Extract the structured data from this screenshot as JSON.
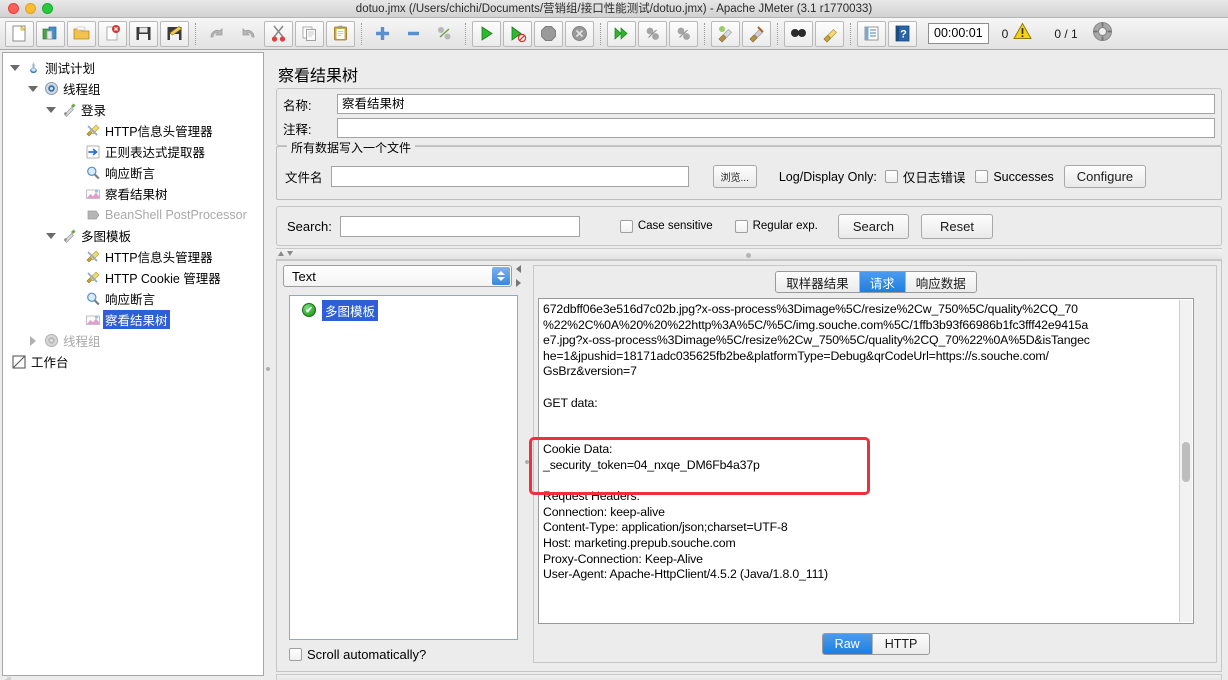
{
  "window": {
    "title": "dotuo.jmx (/Users/chichi/Documents/营销组/接口性能测试/dotuo.jmx) - Apache JMeter (3.1 r1770033)"
  },
  "toolbar": {
    "icons": [
      "new-file-icon",
      "open-template-icon",
      "open-folder-icon",
      "close-icon",
      "save-icon",
      "save-as-icon",
      "undo-icon",
      "redo-icon",
      "cut-icon",
      "copy-icon",
      "paste-icon",
      "expand-all-icon",
      "collapse-all-icon",
      "toggle-icon",
      "start-icon",
      "start-no-pauses-icon",
      "stop-icon",
      "shutdown-icon",
      "start-remote-icon",
      "stop-remote-icon",
      "shutdown-remote-icon",
      "clear-icon",
      "clear-all-icon",
      "search-icon",
      "reset-search-icon",
      "function-helper-icon",
      "help-icon"
    ],
    "timer": "00:00:01",
    "error_count": "0",
    "warning_icon": "warning-triangle-icon",
    "thread_count": "0 / 1",
    "target_icon": "remote-target-icon"
  },
  "tree": {
    "nodes": [
      {
        "label": "测试计划",
        "indent": 0,
        "twisty": "open",
        "icon": "test-plan-icon",
        "selected": false,
        "disabled": false
      },
      {
        "label": "线程组",
        "indent": 1,
        "twisty": "open",
        "icon": "thread-group-icon",
        "selected": false,
        "disabled": false
      },
      {
        "label": "登录",
        "indent": 2,
        "twisty": "open",
        "icon": "http-request-icon",
        "selected": false,
        "disabled": false
      },
      {
        "label": "HTTP信息头管理器",
        "indent": 3,
        "twisty": "none",
        "icon": "header-manager-icon",
        "selected": false,
        "disabled": false
      },
      {
        "label": "正则表达式提取器",
        "indent": 3,
        "twisty": "none",
        "icon": "regex-extractor-icon",
        "selected": false,
        "disabled": false
      },
      {
        "label": "响应断言",
        "indent": 3,
        "twisty": "none",
        "icon": "assertion-icon",
        "selected": false,
        "disabled": false
      },
      {
        "label": "察看结果树",
        "indent": 3,
        "twisty": "none",
        "icon": "view-results-tree-icon",
        "selected": false,
        "disabled": false
      },
      {
        "label": "BeanShell PostProcessor",
        "indent": 3,
        "twisty": "none",
        "icon": "beanshell-icon",
        "selected": false,
        "disabled": true
      },
      {
        "label": "多图模板",
        "indent": 2,
        "twisty": "open",
        "icon": "http-request-icon",
        "selected": false,
        "disabled": false
      },
      {
        "label": "HTTP信息头管理器",
        "indent": 3,
        "twisty": "none",
        "icon": "header-manager-icon",
        "selected": false,
        "disabled": false
      },
      {
        "label": "HTTP Cookie 管理器",
        "indent": 3,
        "twisty": "none",
        "icon": "cookie-manager-icon",
        "selected": false,
        "disabled": false
      },
      {
        "label": "响应断言",
        "indent": 3,
        "twisty": "none",
        "icon": "assertion-icon",
        "selected": false,
        "disabled": false
      },
      {
        "label": "察看结果树",
        "indent": 3,
        "twisty": "none",
        "icon": "view-results-tree-icon",
        "selected": true,
        "disabled": false
      },
      {
        "label": "线程组",
        "indent": 1,
        "twisty": "closed",
        "icon": "thread-group-icon",
        "selected": false,
        "disabled": true
      },
      {
        "label": "工作台",
        "indent": 0,
        "twisty": "none",
        "icon": "workbench-icon",
        "selected": false,
        "disabled": false
      }
    ]
  },
  "panel": {
    "title": "察看结果树",
    "name_label": "名称:",
    "name_value": "察看结果树",
    "comment_label": "注释:",
    "comment_value": "",
    "file_group_legend": "所有数据写入一个文件",
    "filename_label": "文件名",
    "filename_value": "",
    "browse_button": "浏览...",
    "log_display_label": "Log/Display Only:",
    "errors_only_label": "仅日志错误",
    "successes_label": "Successes",
    "configure_button": "Configure"
  },
  "search": {
    "label": "Search:",
    "value": "",
    "case_sensitive_label": "Case sensitive",
    "regular_exp_label": "Regular exp.",
    "search_button": "Search",
    "reset_button": "Reset"
  },
  "results": {
    "renderer_selected": "Text",
    "list_items": [
      {
        "label": "多图模板",
        "status": "ok",
        "badge_glyph": "✔",
        "selected": true
      }
    ],
    "scroll_automatically_label": "Scroll automatically?",
    "tabs": [
      {
        "label": "取样器结果",
        "active": false
      },
      {
        "label": "请求",
        "active": true
      },
      {
        "label": "响应数据",
        "active": false
      }
    ],
    "view_mode_buttons": [
      {
        "label": "Raw",
        "active": true
      },
      {
        "label": "HTTP",
        "active": false
      }
    ],
    "request_text_lines": [
      "672dbff06e3e516d7c02b.jpg?x-oss-process%3Dimage%5C/resize%2Cw_750%5C/quality%2CQ_70",
      "%22%2C%0A%20%20%22http%3A%5C/%5C/img.souche.com%5C/1ffb3b93f66986b1fc3fff42e9415a",
      "e7.jpg?x-oss-process%3Dimage%5C/resize%2Cw_750%5C/quality%2CQ_70%22%0A%5D&isTangec",
      "he=1&jpushid=18171adc035625fb2be&platformType=Debug&qrCodeUrl=https://s.souche.com/",
      "GsBrz&version=7",
      "",
      "GET data:",
      "",
      "",
      "Cookie Data:",
      "_security_token=04_nxqe_DM6Fb4a37p",
      "",
      "Request Headers:",
      "Connection: keep-alive",
      "Content-Type: application/json;charset=UTF-8",
      "Host: marketing.prepub.souche.com",
      "Proxy-Connection: Keep-Alive",
      "User-Agent: Apache-HttpClient/4.5.2 (Java/1.8.0_111)"
    ]
  },
  "colors": {
    "accent_blue": "#2f5fd7",
    "tab_active_blue": "#1f7fe0",
    "highlight_red": "#ef2f3c",
    "window_bg": "#ececec",
    "success_green": "#2fa32f"
  }
}
